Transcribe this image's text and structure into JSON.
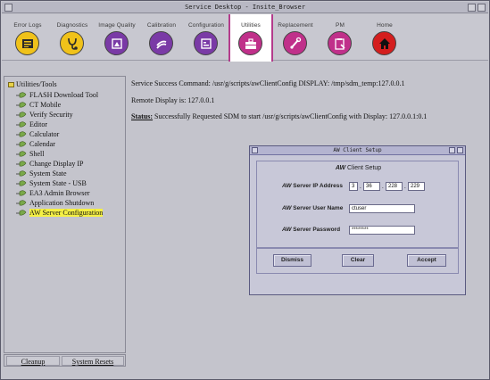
{
  "window": {
    "title": "Service Desktop - Insite_Browser"
  },
  "toolbar": {
    "items": [
      {
        "label": "Error Logs",
        "icon": "error-log-icon",
        "color": "#f0c21a"
      },
      {
        "label": "Diagnostics",
        "icon": "stethoscope-icon",
        "color": "#f0c21a"
      },
      {
        "label": "Image Quality",
        "icon": "image-quality-icon",
        "color": "#7a3aa6"
      },
      {
        "label": "Calibration",
        "icon": "calibration-icon",
        "color": "#7a3aa6"
      },
      {
        "label": "Configuration",
        "icon": "configuration-icon",
        "color": "#7a3aa6"
      },
      {
        "label": "Utilities",
        "icon": "toolbox-icon",
        "color": "#c0308a",
        "active": true
      },
      {
        "label": "Replacement",
        "icon": "replacement-icon",
        "color": "#c0308a"
      },
      {
        "label": "PM",
        "icon": "clipboard-icon",
        "color": "#c0308a"
      },
      {
        "label": "Home",
        "icon": "home-icon",
        "color": "#d41e1e"
      }
    ]
  },
  "sidebar": {
    "root": "Utilities/Tools",
    "items": [
      "FLASH Download Tool",
      "CT Mobile",
      "Verify Security",
      "Editor",
      "Calculator",
      "Calendar",
      "Shell",
      "Change Display IP",
      "System State",
      "System State - USB",
      "EA3 Admin Browser",
      "Application Shutdown",
      "AW Server Configuration"
    ],
    "selected": "AW Server Configuration"
  },
  "bottom_buttons": {
    "cleanup": "Cleanup",
    "system_resets": "System Resets"
  },
  "main": {
    "line1": "Service Success Command: /usr/g/scripts/awClientConfig DISPLAY: /tmp/sdm_temp:127.0.0.1",
    "line2": "Remote Display is: 127.0.0.1",
    "status_label": "Status:",
    "status_text": "Successfully Requested SDM to start /usr/g/scripts/awClientConfig with Display: 127.0.0.1:0.1"
  },
  "dialog": {
    "title": "AW Client Setup",
    "heading_prefix": "AW",
    "heading_rest": "Client Setup",
    "ip_label_prefix": "AW",
    "ip_label_rest": "Server IP Address",
    "ip": [
      "3",
      "36",
      "228",
      "229"
    ],
    "user_label_prefix": "AW",
    "user_label_rest": "Server User Name",
    "user_value": "ctuser",
    "password_label_prefix": "AW",
    "password_label_rest": "Server Password",
    "password_value": "********",
    "dismiss": "Dismiss",
    "clear": "Clear",
    "accept": "Accept"
  }
}
